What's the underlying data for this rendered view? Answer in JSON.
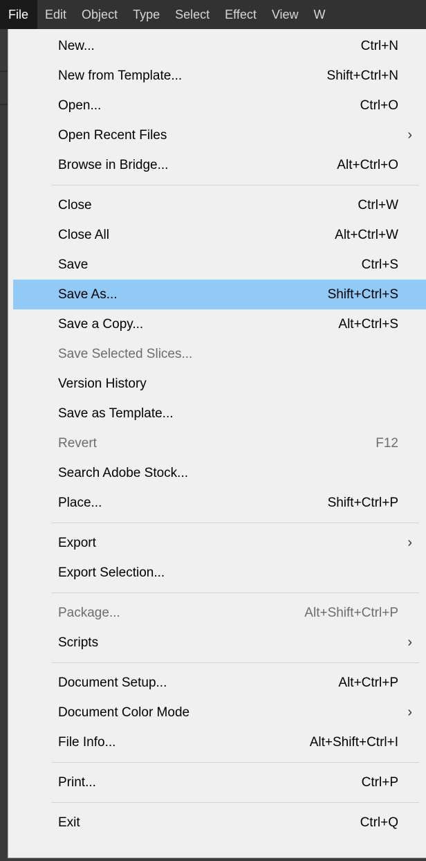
{
  "menubar": {
    "items": [
      {
        "label": "File"
      },
      {
        "label": "Edit"
      },
      {
        "label": "Object"
      },
      {
        "label": "Type"
      },
      {
        "label": "Select"
      },
      {
        "label": "Effect"
      },
      {
        "label": "View"
      },
      {
        "label": "W"
      }
    ]
  },
  "file_menu": {
    "groups": [
      [
        {
          "label": "New...",
          "shortcut": "Ctrl+N"
        },
        {
          "label": "New from Template...",
          "shortcut": "Shift+Ctrl+N"
        },
        {
          "label": "Open...",
          "shortcut": "Ctrl+O"
        },
        {
          "label": "Open Recent Files",
          "shortcut": "",
          "submenu": true
        },
        {
          "label": "Browse in Bridge...",
          "shortcut": "Alt+Ctrl+O"
        }
      ],
      [
        {
          "label": "Close",
          "shortcut": "Ctrl+W"
        },
        {
          "label": "Close All",
          "shortcut": "Alt+Ctrl+W"
        },
        {
          "label": "Save",
          "shortcut": "Ctrl+S"
        },
        {
          "label": "Save As...",
          "shortcut": "Shift+Ctrl+S",
          "highlighted": true
        },
        {
          "label": "Save a Copy...",
          "shortcut": "Alt+Ctrl+S"
        },
        {
          "label": "Save Selected Slices...",
          "shortcut": "",
          "disabled": true
        },
        {
          "label": "Version History",
          "shortcut": ""
        },
        {
          "label": "Save as Template...",
          "shortcut": ""
        },
        {
          "label": "Revert",
          "shortcut": "F12",
          "disabled": true
        },
        {
          "label": "Search Adobe Stock...",
          "shortcut": ""
        },
        {
          "label": "Place...",
          "shortcut": "Shift+Ctrl+P"
        }
      ],
      [
        {
          "label": "Export",
          "shortcut": "",
          "submenu": true
        },
        {
          "label": "Export Selection...",
          "shortcut": ""
        }
      ],
      [
        {
          "label": "Package...",
          "shortcut": "Alt+Shift+Ctrl+P",
          "disabled": true
        },
        {
          "label": "Scripts",
          "shortcut": "",
          "submenu": true
        }
      ],
      [
        {
          "label": "Document Setup...",
          "shortcut": "Alt+Ctrl+P"
        },
        {
          "label": "Document Color Mode",
          "shortcut": "",
          "submenu": true
        },
        {
          "label": "File Info...",
          "shortcut": "Alt+Shift+Ctrl+I"
        }
      ],
      [
        {
          "label": "Print...",
          "shortcut": "Ctrl+P"
        }
      ],
      [
        {
          "label": "Exit",
          "shortcut": "Ctrl+Q"
        }
      ]
    ],
    "submenu_arrow": "›"
  },
  "colors": {
    "menubar_bg": "#323232",
    "menubar_active_bg": "#1a1a1a",
    "dropdown_bg": "#f0f0f0",
    "highlight_bg": "#91c9f7",
    "disabled_text": "#6d6d6d"
  }
}
